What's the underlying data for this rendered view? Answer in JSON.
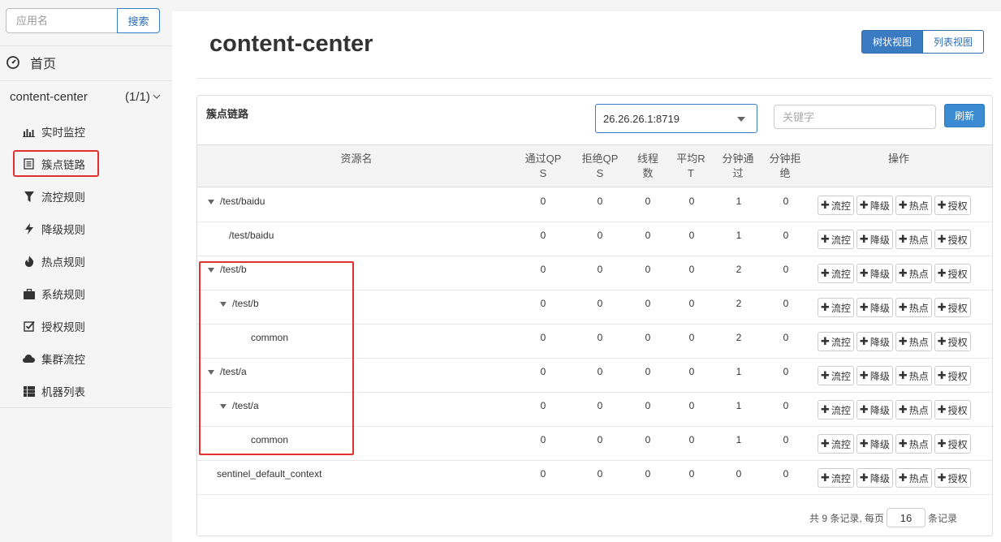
{
  "sidebar": {
    "search_placeholder": "应用名",
    "search_button": "搜索",
    "home_label": "首页",
    "app_name": "content-center",
    "app_count": "(1/1)",
    "menu": [
      {
        "label": "实时监控",
        "icon": "bar-chart-icon"
      },
      {
        "label": "簇点链路",
        "icon": "list-icon"
      },
      {
        "label": "流控规则",
        "icon": "filter-icon"
      },
      {
        "label": "降级规则",
        "icon": "bolt-icon"
      },
      {
        "label": "热点规则",
        "icon": "fire-icon"
      },
      {
        "label": "系统规则",
        "icon": "briefcase-icon"
      },
      {
        "label": "授权规则",
        "icon": "check-square-icon"
      },
      {
        "label": "集群流控",
        "icon": "cloud-icon"
      },
      {
        "label": "机器列表",
        "icon": "th-large-icon"
      }
    ]
  },
  "header": {
    "title": "content-center",
    "tree_view": "树状视图",
    "list_view": "列表视图"
  },
  "panel": {
    "title": "簇点链路",
    "machine": "26.26.26.1:8719",
    "keyword_placeholder": "关键字",
    "refresh": "刷新"
  },
  "table": {
    "headers": {
      "resource": "资源名",
      "pass_qps": [
        "通过QP",
        "S"
      ],
      "block_qps": [
        "拒绝QP",
        "S"
      ],
      "threads": [
        "线程",
        "数"
      ],
      "avg_rt": [
        "平均R",
        "T"
      ],
      "min_pass": [
        "分钟通",
        "过"
      ],
      "min_block": [
        "分钟拒",
        "绝"
      ],
      "ops": "操作"
    },
    "ops_labels": [
      "流控",
      "降级",
      "热点",
      "授权"
    ],
    "rows": [
      {
        "name": "/test/baidu",
        "level": 0,
        "expand": true,
        "pass": "0",
        "block": "0",
        "thread": "0",
        "rt": "0",
        "minpass": "1",
        "minblock": "0"
      },
      {
        "name": "/test/baidu",
        "level": 1,
        "expand": false,
        "pass": "0",
        "block": "0",
        "thread": "0",
        "rt": "0",
        "minpass": "1",
        "minblock": "0"
      },
      {
        "name": "/test/b",
        "level": 0,
        "expand": true,
        "pass": "0",
        "block": "0",
        "thread": "0",
        "rt": "0",
        "minpass": "2",
        "minblock": "0"
      },
      {
        "name": "/test/b",
        "level": 1,
        "expand": true,
        "pass": "0",
        "block": "0",
        "thread": "0",
        "rt": "0",
        "minpass": "2",
        "minblock": "0"
      },
      {
        "name": "common",
        "level": 2,
        "expand": false,
        "pass": "0",
        "block": "0",
        "thread": "0",
        "rt": "0",
        "minpass": "2",
        "minblock": "0"
      },
      {
        "name": "/test/a",
        "level": 0,
        "expand": true,
        "pass": "0",
        "block": "0",
        "thread": "0",
        "rt": "0",
        "minpass": "1",
        "minblock": "0"
      },
      {
        "name": "/test/a",
        "level": 1,
        "expand": true,
        "pass": "0",
        "block": "0",
        "thread": "0",
        "rt": "0",
        "minpass": "1",
        "minblock": "0"
      },
      {
        "name": "common",
        "level": 2,
        "expand": false,
        "pass": "0",
        "block": "0",
        "thread": "0",
        "rt": "0",
        "minpass": "1",
        "minblock": "0"
      },
      {
        "name": "sentinel_default_context",
        "level": 0,
        "expand": false,
        "pass": "0",
        "block": "0",
        "thread": "0",
        "rt": "0",
        "minpass": "0",
        "minblock": "0"
      }
    ]
  },
  "pager": {
    "prefix": "共 9 条记录, 每页",
    "page_size": "16",
    "suffix": "条记录"
  },
  "colors": {
    "primary": "#3a7bc1",
    "highlight": "#e0312f"
  }
}
